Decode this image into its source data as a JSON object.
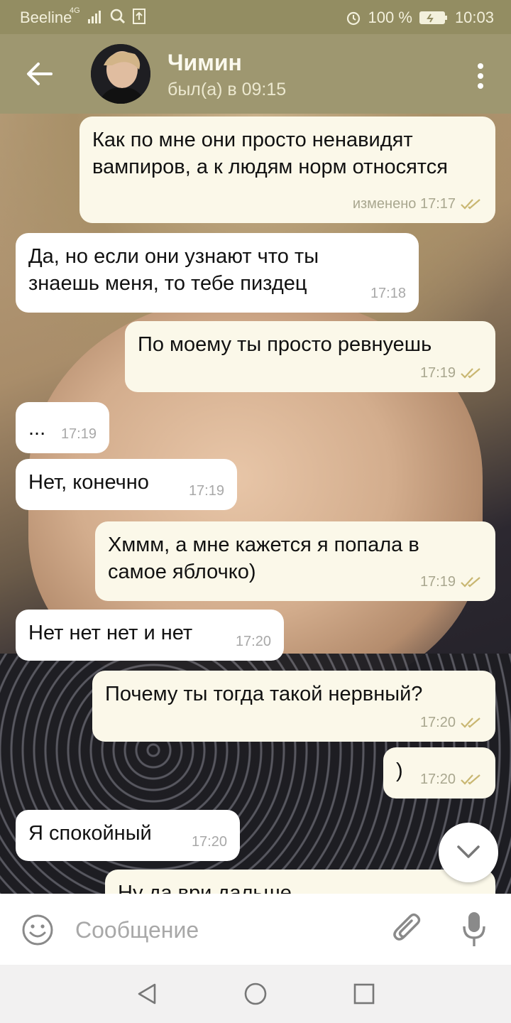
{
  "status_bar": {
    "carrier": "Beeline",
    "network": "4G",
    "battery": "100 %",
    "time": "10:03"
  },
  "header": {
    "contact_name": "Чимин",
    "last_seen": "был(а) в 09:15"
  },
  "messages": [
    {
      "direction": "out",
      "text": "Как по мне они просто ненавидят вампиров, а к людям норм относятся",
      "meta": "изменено 17:17"
    },
    {
      "direction": "in",
      "text": "Да, но если они узнают что ты знаешь меня, то тебе пиздец",
      "meta": "17:18"
    },
    {
      "direction": "out",
      "text": "По моему ты просто ревнуешь",
      "meta": "17:19"
    },
    {
      "direction": "in",
      "text": "...",
      "meta": "17:19"
    },
    {
      "direction": "in",
      "text": "Нет, конечно",
      "meta": "17:19"
    },
    {
      "direction": "out",
      "text": "Хммм, а мне кажется я попала в самое яблочко)",
      "meta": "17:19"
    },
    {
      "direction": "in",
      "text": "Нет нет нет и нет",
      "meta": "17:20"
    },
    {
      "direction": "out",
      "text": "Почему ты тогда такой нервный?",
      "meta": "17:20"
    },
    {
      "direction": "out",
      "text": ")",
      "meta": "17:20"
    },
    {
      "direction": "in",
      "text": "Я спокойный",
      "meta": "17:20"
    },
    {
      "direction": "out",
      "text": "Ну да ври дальше",
      "meta": ""
    }
  ],
  "composer": {
    "placeholder": "Сообщение"
  },
  "colors": {
    "header": "#9e9770",
    "status_bar": "#938d62",
    "outgoing_bubble": "#fbf8e9",
    "incoming_bubble": "#ffffff",
    "read_ticks": "#c9b772"
  },
  "icons": {
    "back": "arrow-left-icon",
    "menu": "more-vertical-icon",
    "scroll_down": "chevron-down-icon",
    "emoji": "smiley-icon",
    "attach": "paperclip-icon",
    "mic": "microphone-icon"
  }
}
